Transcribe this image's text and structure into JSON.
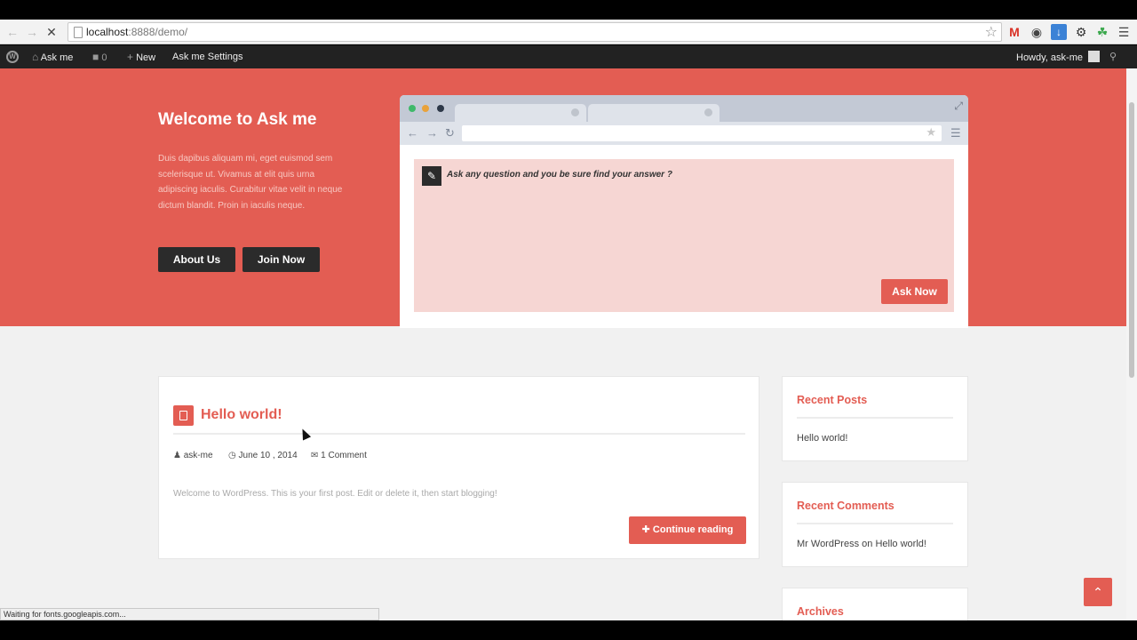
{
  "browser": {
    "url_host": "localhost",
    "url_rest": ":8888/demo/",
    "status_text": "Waiting for fonts.googleapis.com..."
  },
  "adminbar": {
    "site_name": "Ask me",
    "comments_count": "0",
    "new_label": "New",
    "settings_label": "Ask me Settings",
    "howdy": "Howdy, ask-me"
  },
  "hero": {
    "title": "Welcome to Ask me",
    "description": "Duis dapibus aliquam mi, eget euismod sem scelerisque ut. Vivamus at elit quis urna adipiscing iaculis. Curabitur vitae velit in neque dictum blandit. Proin in iaculis neque.",
    "about_button": "About Us",
    "join_button": "Join Now",
    "ask_placeholder": "Ask any question and you be sure find your answer ?",
    "ask_button": "Ask Now"
  },
  "post": {
    "title": "Hello world!",
    "author": "ask-me",
    "date": "June 10 , 2014",
    "comments": "1 Comment",
    "excerpt": "Welcome to WordPress. This is your first post. Edit or delete it, then start blogging!",
    "continue_label": "Continue reading"
  },
  "sidebar": {
    "recent_posts": {
      "title": "Recent Posts",
      "items": [
        "Hello world!"
      ]
    },
    "recent_comments": {
      "title": "Recent Comments",
      "author": "Mr WordPress",
      "on": "on",
      "post": "Hello world!"
    },
    "archives": {
      "title": "Archives"
    }
  },
  "colors": {
    "accent": "#e35d53",
    "dark": "#2b2b2b",
    "page_bg": "#f1f1f1"
  },
  "icons": [
    "back-arrow-icon",
    "forward-arrow-icon",
    "stop-icon",
    "page-icon",
    "bookmark-star-icon",
    "gmail-icon",
    "extension-icon",
    "download-icon",
    "settings-gear-icon",
    "leaf-icon",
    "menu-icon",
    "wordpress-logo-icon",
    "home-icon",
    "comment-icon",
    "plus-icon",
    "search-icon",
    "pencil-icon",
    "document-icon",
    "user-icon",
    "clock-icon",
    "comments-icon",
    "chevron-up-icon"
  ]
}
